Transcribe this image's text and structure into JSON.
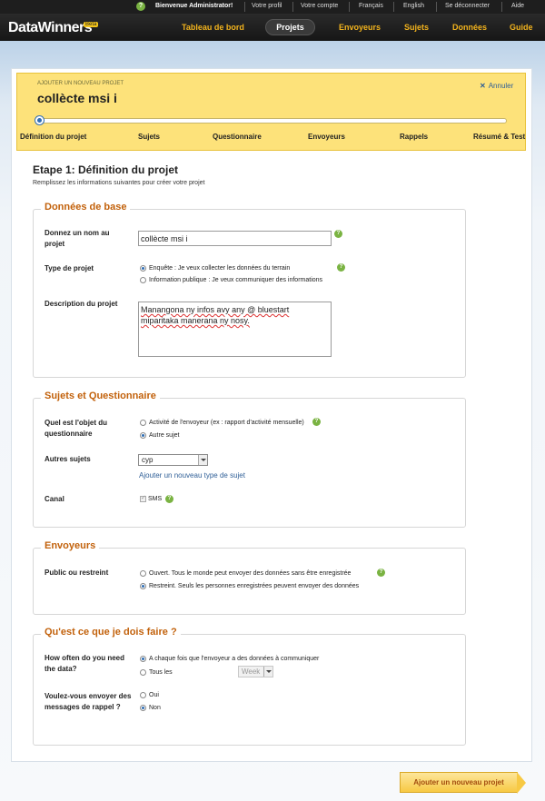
{
  "topbar": {
    "welcome": "Bienvenue Administrator!",
    "profile": "Votre profil",
    "account": "Votre compte",
    "lang_fr": "Français",
    "lang_en": "English",
    "logout": "Se déconnecter",
    "help": "Aide"
  },
  "nav": {
    "logo": "DataWinners",
    "beta": "Beta",
    "items": [
      "Tableau de bord",
      "Projets",
      "Envoyeurs",
      "Sujets",
      "Données",
      "Guide"
    ],
    "active": "Projets"
  },
  "banner": {
    "subtitle": "AJOUTER UN NOUVEAU PROJET",
    "project_name": "collècte msi i",
    "cancel_label": "Annuler",
    "progress_step": 1,
    "steps": [
      "Définition du projet",
      "Sujets",
      "Questionnaire",
      "Envoyeurs",
      "Rappels",
      "Résumé & Test"
    ]
  },
  "page": {
    "heading": "Etape 1: Définition du projet",
    "subheading": "Remplissez les informations suivantes pour créer votre projet"
  },
  "basic": {
    "legend": "Données de base",
    "name_label": "Donnez un nom au projet",
    "name_value": "collècte msi i",
    "type_label": "Type de projet",
    "type_options": [
      "Enquête : Je veux collecter les données du terrain",
      "Information publique : Je veux communiquer des informations"
    ],
    "type_selected": 0,
    "desc_label": "Description du projet",
    "desc_value": "Manangona ny infos avy any @ bluestart miparitaka manerana ny nosy."
  },
  "subjects": {
    "legend": "Sujets et Questionnaire",
    "object_label": "Quel est l'objet du questionnaire",
    "object_options": [
      "Activité de l'envoyeur (ex : rapport d'activité mensuelle)",
      "Autre sujet"
    ],
    "object_selected": 1,
    "other_label": "Autres sujets",
    "other_value": "cyp",
    "add_subject_link": "Ajouter un nouveau type de sujet",
    "channel_label": "Canal",
    "channel_sms": "SMS"
  },
  "senders": {
    "legend": "Envoyeurs",
    "access_label": "Public ou restreint",
    "access_options": [
      "Ouvert. Tous le monde peut envoyer des données sans être enregistrée",
      "Restreint. Seuls les personnes enregistrées peuvent envoyer des données"
    ],
    "access_selected": 1
  },
  "todo": {
    "legend": "Qu'est ce que je dois faire ?",
    "freq_label": "How often do you need the data?",
    "freq_options": [
      "A chaque fois que l'envoyeur a des données à communiquer",
      "Tous les"
    ],
    "freq_selected": 0,
    "freq_unit": "Week",
    "reminder_label": "Voulez-vous envoyer des messages de rappel ?",
    "reminder_options": [
      "Oui",
      "Non"
    ],
    "reminder_selected": 1
  },
  "footer": {
    "add_button": "Ajouter un nouveau projet"
  },
  "help_glyph": "?"
}
